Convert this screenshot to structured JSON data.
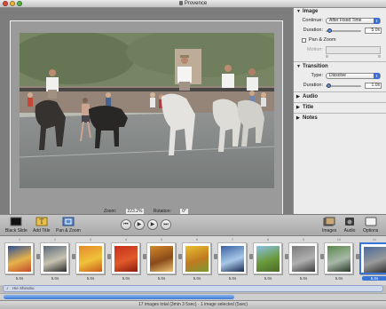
{
  "window": {
    "title": "Provence"
  },
  "viewer": {
    "zoom_label": "Zoom:",
    "zoom_value": "223.2%",
    "rotation_label": "Rotation:",
    "rotation_value": "0°"
  },
  "inspector": {
    "image": {
      "header": "Image",
      "continue_label": "Continue:",
      "continue_value": "After Fixed Time",
      "duration_label": "Duration:",
      "duration_value": "5.0s",
      "pan_zoom_label": "Pan & Zoom",
      "motion_label": "Motion:"
    },
    "transition": {
      "header": "Transition",
      "type_label": "Type:",
      "type_value": "Dissolve",
      "duration_label": "Duration:",
      "duration_value": "1.0s"
    },
    "collapsed": [
      "Audio",
      "Title",
      "Notes"
    ]
  },
  "toolbar": {
    "black_slide": "Black Slide",
    "add_title": "Add Title",
    "pan_zoom": "Pan & Zoom",
    "images": "Images",
    "audio": "Audio",
    "options": "Options",
    "options_value": "5"
  },
  "filmstrip": {
    "slides": [
      {
        "num": "1",
        "dur": "5.0s",
        "palette": [
          "#2c4e9a",
          "#e6b34a",
          "#c34a2a"
        ]
      },
      {
        "num": "2",
        "dur": "5.0s",
        "palette": [
          "#5a6a7a",
          "#c8c2b0",
          "#2a2a2a"
        ]
      },
      {
        "num": "3",
        "dur": "5.0s",
        "palette": [
          "#e38a2a",
          "#f0c23a",
          "#c85a1a"
        ]
      },
      {
        "num": "4",
        "dur": "5.0s",
        "palette": [
          "#c5301c",
          "#e05a2a",
          "#8c1a10"
        ]
      },
      {
        "num": "5",
        "dur": "5.0s",
        "palette": [
          "#d48a2a",
          "#8a4a1a",
          "#e8c070"
        ]
      },
      {
        "num": "6",
        "dur": "5.0s",
        "palette": [
          "#e8c030",
          "#c07a20",
          "#7a9a30"
        ]
      },
      {
        "num": "7",
        "dur": "5.0s",
        "palette": [
          "#3a5fa0",
          "#a8c8e8",
          "#1a2a50"
        ]
      },
      {
        "num": "8",
        "dur": "5.0s",
        "palette": [
          "#8ac0e8",
          "#6a9a3a",
          "#4a6a2a"
        ]
      },
      {
        "num": "9",
        "dur": "5.0s",
        "palette": [
          "#7a7a7a",
          "#b0b0b0",
          "#3a3a3a"
        ]
      },
      {
        "num": "10",
        "dur": "5.0s",
        "palette": [
          "#5a8a4a",
          "#a8b8a8",
          "#2a3a2a"
        ]
      },
      {
        "num": "11",
        "dur": "5.0s",
        "palette": [
          "#4a6a9a",
          "#9a9a9a",
          "#303030"
        ],
        "selected": true
      }
    ]
  },
  "audio_track": {
    "label": "Hie Shinobu"
  },
  "status": {
    "text": "17 images total (3min 3 5sec) · 1 image selected (5sec)"
  },
  "colors": {
    "accent": "#3875d7",
    "inspector_bg": "#ececec",
    "viewer_bg": "#7d7d7d"
  }
}
